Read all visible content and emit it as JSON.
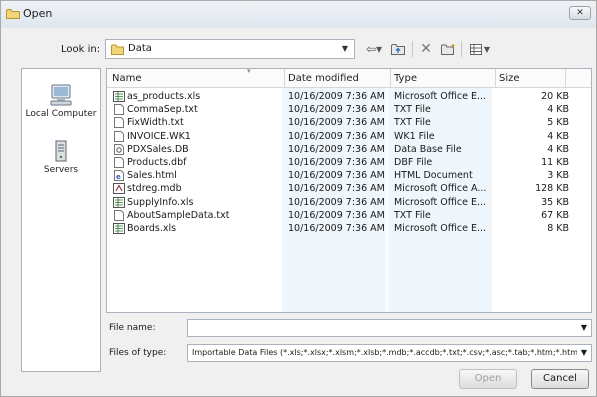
{
  "window": {
    "title": "Open",
    "close_icon": "close-icon"
  },
  "lookin": {
    "label": "Look in:",
    "value": "Data"
  },
  "toolbar": [
    "back-icon",
    "up-folder-icon",
    "delete-icon",
    "new-folder-icon",
    "views-icon"
  ],
  "places": [
    {
      "label": "Local Computer",
      "icon": "computer-icon"
    },
    {
      "label": "Servers",
      "icon": "server-icon"
    }
  ],
  "columns": {
    "name": "Name",
    "date": "Date modified",
    "type": "Type",
    "size": "Size"
  },
  "files": [
    {
      "name": "as_products.xls",
      "date": "10/16/2009 7:36 AM",
      "type": "Microsoft Office E...",
      "size": "20 KB",
      "icon": "excel-file-icon"
    },
    {
      "name": "CommaSep.txt",
      "date": "10/16/2009 7:36 AM",
      "type": "TXT File",
      "size": "4 KB",
      "icon": "text-file-icon"
    },
    {
      "name": "FixWidth.txt",
      "date": "10/16/2009 7:36 AM",
      "type": "TXT File",
      "size": "5 KB",
      "icon": "text-file-icon"
    },
    {
      "name": "INVOICE.WK1",
      "date": "10/16/2009 7:36 AM",
      "type": "WK1 File",
      "size": "4 KB",
      "icon": "generic-file-icon"
    },
    {
      "name": "PDXSales.DB",
      "date": "10/16/2009 7:36 AM",
      "type": "Data Base File",
      "size": "4 KB",
      "icon": "database-file-icon"
    },
    {
      "name": "Products.dbf",
      "date": "10/16/2009 7:36 AM",
      "type": "DBF File",
      "size": "11 KB",
      "icon": "generic-file-icon"
    },
    {
      "name": "Sales.html",
      "date": "10/16/2009 7:36 AM",
      "type": "HTML Document",
      "size": "3 KB",
      "icon": "html-file-icon"
    },
    {
      "name": "stdreg.mdb",
      "date": "10/16/2009 7:36 AM",
      "type": "Microsoft Office A...",
      "size": "128 KB",
      "icon": "access-file-icon"
    },
    {
      "name": "SupplyInfo.xls",
      "date": "10/16/2009 7:36 AM",
      "type": "Microsoft Office E...",
      "size": "35 KB",
      "icon": "excel-file-icon"
    },
    {
      "name": "AboutSampleData.txt",
      "date": "10/16/2009 7:36 AM",
      "type": "TXT File",
      "size": "67 KB",
      "icon": "text-file-icon"
    },
    {
      "name": "Boards.xls",
      "date": "10/16/2009 7:36 AM",
      "type": "Microsoft Office E...",
      "size": "8 KB",
      "icon": "excel-file-icon"
    }
  ],
  "filename": {
    "label": "File name:",
    "value": ""
  },
  "filetype": {
    "label": "Files of type:",
    "value": "Importable Data Files (*.xls;*.xlsx;*.xlsm;*.xlsb;*.mdb;*.accdb;*.txt;*.csv;*.asc;*.tab;*.htm;*.html;"
  },
  "buttons": {
    "open": "Open",
    "cancel": "Cancel"
  }
}
